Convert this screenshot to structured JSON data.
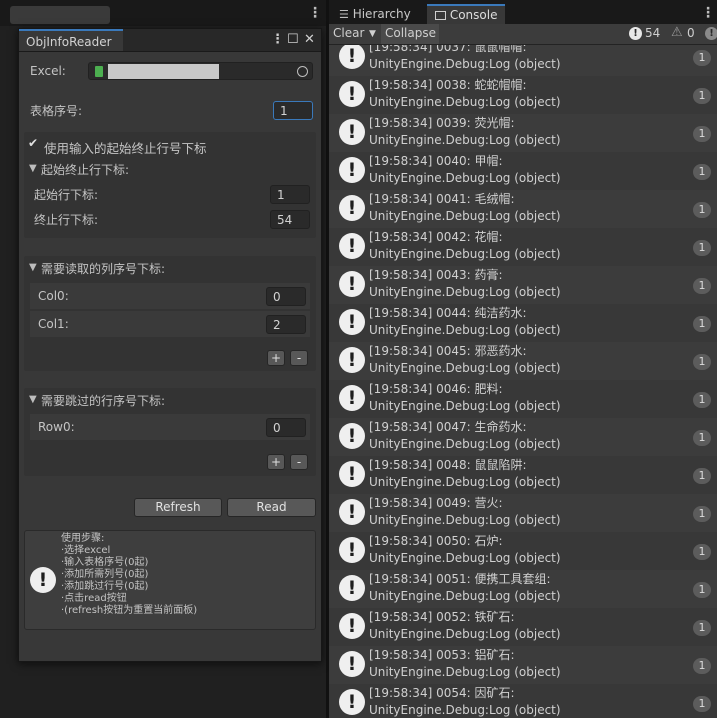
{
  "left_panel": {
    "window_tab": "ObjInfoReader",
    "menu_glyph": "⋮",
    "maximize_glyph": "☐",
    "close_glyph": "✕",
    "excel_label": "Excel:",
    "table_index_label": "表格序号:",
    "table_index_value": "1",
    "use_range_label": "使用输入的起始终止行号下标",
    "use_range_checked": true,
    "range_group_title": "起始终止行下标:",
    "start_row_label": "起始行下标:",
    "start_row_value": "1",
    "end_row_label": "终止行下标:",
    "end_row_value": "54",
    "columns_group_title": "需要读取的列序号下标:",
    "columns": [
      {
        "label": "Col0:",
        "value": "0"
      },
      {
        "label": "Col1:",
        "value": "2"
      }
    ],
    "skip_group_title": "需要跳过的行序号下标:",
    "skip_rows": [
      {
        "label": "Row0:",
        "value": "0"
      }
    ],
    "plus_label": "+",
    "minus_label": "-",
    "refresh_label": "Refresh",
    "read_label": "Read",
    "help_lines": [
      "使用步骤:",
      "·选择excel",
      "·输入表格序号(0起)",
      "·添加所需列号(0起)",
      "·添加跳过行号(0起)",
      "·点击read按钮",
      "·(refresh按钮为重置当前面板)"
    ]
  },
  "console": {
    "tabs": [
      "Hierarchy",
      "Console"
    ],
    "active_tab": "Console",
    "toolbar": {
      "clear_label": "Clear",
      "collapse_label": "Collapse",
      "info_count": "54",
      "warning_count": "0",
      "error_count": "0"
    },
    "log_second_line": "UnityEngine.Debug:Log (object)",
    "entries": [
      {
        "text": "[19:58:34] 0037: 鼠鼠帽帽:",
        "count": "1"
      },
      {
        "text": "[19:58:34] 0038: 蛇蛇帽帽:",
        "count": "1"
      },
      {
        "text": "[19:58:34] 0039: 荧光帽:",
        "count": "1"
      },
      {
        "text": "[19:58:34] 0040: 甲帽:",
        "count": "1"
      },
      {
        "text": "[19:58:34] 0041: 毛绒帽:",
        "count": "1"
      },
      {
        "text": "[19:58:34] 0042: 花帽:",
        "count": "1"
      },
      {
        "text": "[19:58:34] 0043: 药膏:",
        "count": "1"
      },
      {
        "text": "[19:58:34] 0044: 纯洁药水:",
        "count": "1"
      },
      {
        "text": "[19:58:34] 0045: 邪恶药水:",
        "count": "1"
      },
      {
        "text": "[19:58:34] 0046: 肥料:",
        "count": "1"
      },
      {
        "text": "[19:58:34] 0047: 生命药水:",
        "count": "1"
      },
      {
        "text": "[19:58:34] 0048: 鼠鼠陷阱:",
        "count": "1"
      },
      {
        "text": "[19:58:34] 0049: 营火:",
        "count": "1"
      },
      {
        "text": "[19:58:34] 0050: 石炉:",
        "count": "1"
      },
      {
        "text": "[19:58:34] 0051: 便携工具套组:",
        "count": "1"
      },
      {
        "text": "[19:58:34] 0052: 铁矿石:",
        "count": "1"
      },
      {
        "text": "[19:58:34] 0053: 铝矿石:",
        "count": "1"
      },
      {
        "text": "[19:58:34] 0054: 因矿石:",
        "count": "1"
      }
    ]
  }
}
